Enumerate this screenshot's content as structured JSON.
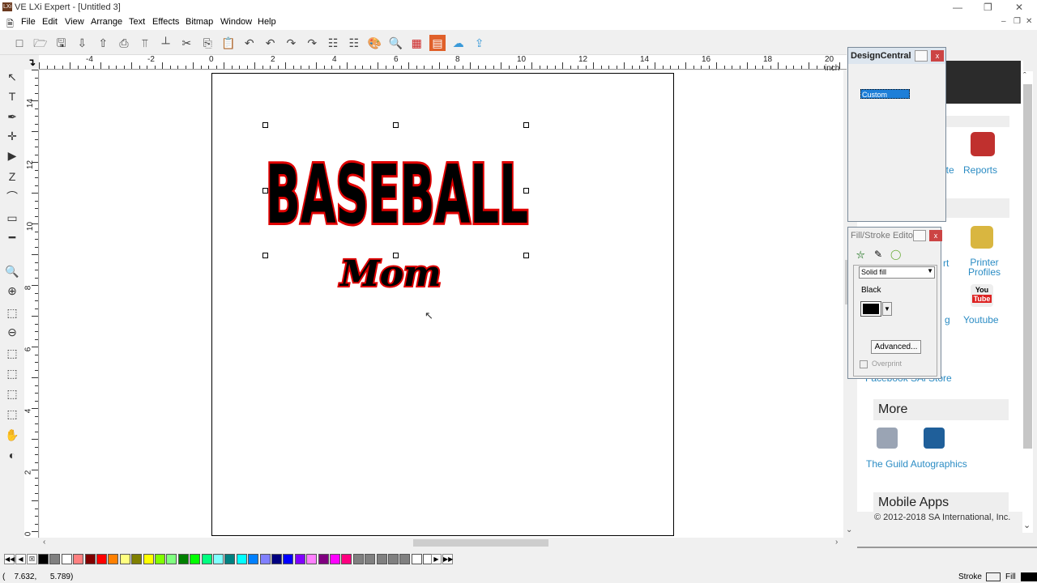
{
  "window": {
    "title": "VE LXi Expert - [Untitled 3]",
    "app_icon": "LXi",
    "controls": [
      "minimize",
      "restore",
      "close"
    ]
  },
  "menu": [
    "File",
    "Edit",
    "View",
    "Arrange",
    "Text",
    "Effects",
    "Bitmap",
    "Window",
    "Help"
  ],
  "toolbar": [
    "new-icon",
    "open-icon",
    "save-icon",
    "import-icon",
    "export-icon",
    "print-icon",
    "cut-output-icon",
    "stamp-icon",
    "cut-icon",
    "copy-icon",
    "paste-icon",
    "undo-icon",
    "undo-list-icon",
    "redo-icon",
    "redo-list-icon",
    "properties-icon",
    "job-manager-icon",
    "palette-icon",
    "inspect-icon",
    "color-chart-icon",
    "reports-icon",
    "cloud-icon",
    "upload-icon"
  ],
  "rulers": {
    "unit": "inch",
    "h_ticks": [
      "-4",
      "-2",
      "0",
      "2",
      "4",
      "6",
      "8",
      "10",
      "12",
      "14",
      "16",
      "18",
      "20 inch"
    ],
    "v_ticks": [
      "14",
      "12",
      "10",
      "8",
      "6",
      "4",
      "2",
      "0"
    ]
  },
  "design": {
    "main_text": "BASEBALL",
    "sub_text": "Mom",
    "fill": "#000000",
    "stroke": "#e00000"
  },
  "design_central": {
    "title": "DesignCentral",
    "selected": "Custom"
  },
  "fill_stroke": {
    "title": "Fill/Stroke Editor",
    "fill_type": "Solid fill",
    "color_name": "Black",
    "color": "#000000",
    "advanced": "Advanced...",
    "overprint": "Overprint",
    "overprint_checked": false
  },
  "web": {
    "items": [
      {
        "label": "Reports",
        "partial": "ote"
      },
      {
        "label": "Printer Profiles",
        "partial": "rt"
      },
      {
        "label": "Youtube",
        "partial": "g"
      }
    ],
    "partial_bottom": "Facebook  SAi Store",
    "more_heading": "More",
    "more_link": "The Guild Autographics",
    "mobile_heading": "Mobile Apps",
    "copyright": "© 2012-2018 SA International, Inc."
  },
  "palette": [
    "#000000",
    "#808080",
    "#ffffff",
    "#ff8080",
    "#800000",
    "#ff0000",
    "#ff8000",
    "#ffff80",
    "#808000",
    "#ffff00",
    "#80ff00",
    "#80ff80",
    "#008000",
    "#00ff00",
    "#00ff80",
    "#80ffff",
    "#008080",
    "#00ffff",
    "#0080ff",
    "#8080ff",
    "#000080",
    "#0000ff",
    "#8000ff",
    "#ff80ff",
    "#800080",
    "#ff00ff",
    "#ff0080",
    "#808080",
    "#808080",
    "#808080",
    "#808080",
    "#808080",
    "#ffffff",
    "#ffffff"
  ],
  "status": {
    "coords": "(    7.632,      5.789)",
    "stroke_label": "Stroke",
    "fill_label": "Fill"
  }
}
